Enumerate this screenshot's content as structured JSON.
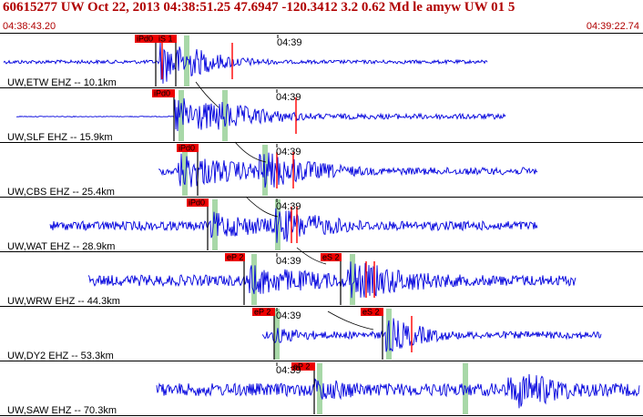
{
  "header": {
    "title": "60615277 UW Oct 22, 2013 04:38:51.25   47.6947 -120.3412  3.2 0.62 Md le amyw UW 01    5",
    "start_time": "04:38:43.20",
    "end_time": "04:39:22.74"
  },
  "colors": {
    "header_text": "#b00000",
    "trace": "#0000dd",
    "pick_box": "#ee0000",
    "pick_line": "#ff0000",
    "marker_band": "#a8d8a8"
  },
  "channels": [
    {
      "label": "UW,ETW EHZ -- 10.1km",
      "tick": "04:39",
      "picks": [
        {
          "label": "iPd0"
        },
        {
          "label": "iS 1"
        }
      ]
    },
    {
      "label": "UW,SLF EHZ -- 15.9km",
      "tick": "04:39",
      "picks": [
        {
          "label": "iPd0"
        }
      ]
    },
    {
      "label": "UW,CBS EHZ -- 25.4km",
      "tick": "04:39",
      "picks": [
        {
          "label": "iPd0"
        }
      ]
    },
    {
      "label": "UW,WAT EHZ -- 28.9km",
      "tick": "04:39",
      "picks": [
        {
          "label": "iPd0"
        }
      ]
    },
    {
      "label": "UW,WRW EHZ -- 44.3km",
      "tick": "04:39",
      "picks": [
        {
          "label": "eP 2"
        },
        {
          "label": "eS 2"
        }
      ]
    },
    {
      "label": "UW,DY2 EHZ -- 53.3km",
      "tick": "04:39",
      "picks": [
        {
          "label": "eP 2"
        },
        {
          "label": "eS 2"
        }
      ]
    },
    {
      "label": "UW,SAW EHZ -- 70.3km",
      "tick": "04:39",
      "picks": [
        {
          "label": "eP 2"
        }
      ]
    }
  ]
}
